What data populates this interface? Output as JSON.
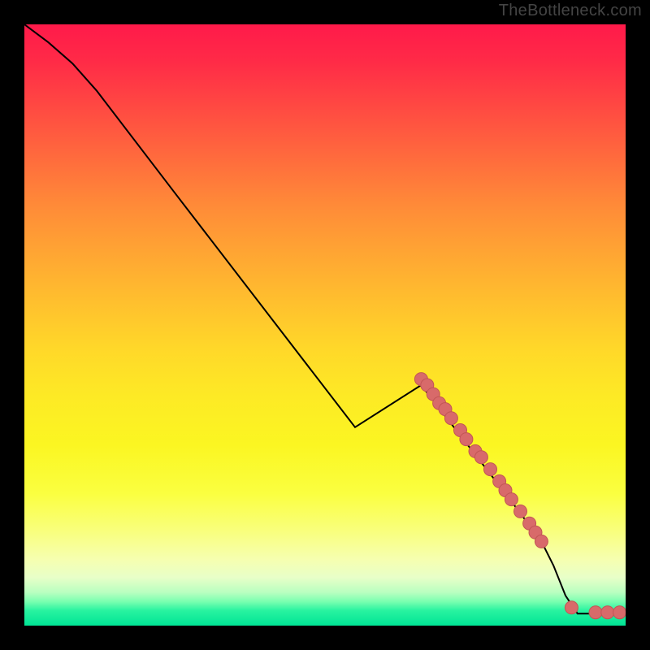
{
  "watermark": "TheBottleneck.com",
  "colors": {
    "curve_stroke": "#000000",
    "marker_fill": "#d86a6a",
    "marker_stroke": "#c25555"
  },
  "chart_data": {
    "type": "line",
    "title": "",
    "xlabel": "",
    "ylabel": "",
    "xlim": [
      0,
      100
    ],
    "ylim": [
      0,
      100
    ],
    "grid": false,
    "legend": false,
    "curve": [
      {
        "x": 0,
        "y": 100
      },
      {
        "x": 4,
        "y": 97
      },
      {
        "x": 8,
        "y": 93.5
      },
      {
        "x": 12,
        "y": 89
      },
      {
        "x": 25,
        "y": 72
      },
      {
        "x": 40,
        "y": 52.5
      },
      {
        "x": 55,
        "y": 33
      },
      {
        "x": 66,
        "y": 40
      },
      {
        "x": 80,
        "y": 22
      },
      {
        "x": 86,
        "y": 14
      },
      {
        "x": 88,
        "y": 10
      },
      {
        "x": 90,
        "y": 5
      },
      {
        "x": 92,
        "y": 2
      },
      {
        "x": 95,
        "y": 2
      },
      {
        "x": 100,
        "y": 2
      }
    ],
    "markers": [
      {
        "x": 66,
        "y": 41
      },
      {
        "x": 67,
        "y": 40
      },
      {
        "x": 68,
        "y": 38.5
      },
      {
        "x": 69,
        "y": 37
      },
      {
        "x": 70,
        "y": 36
      },
      {
        "x": 71,
        "y": 34.5
      },
      {
        "x": 72.5,
        "y": 32.5
      },
      {
        "x": 73.5,
        "y": 31
      },
      {
        "x": 75,
        "y": 29
      },
      {
        "x": 76,
        "y": 28
      },
      {
        "x": 77.5,
        "y": 26
      },
      {
        "x": 79,
        "y": 24
      },
      {
        "x": 80,
        "y": 22.5
      },
      {
        "x": 81,
        "y": 21
      },
      {
        "x": 82.5,
        "y": 19
      },
      {
        "x": 84,
        "y": 17
      },
      {
        "x": 85,
        "y": 15.5
      },
      {
        "x": 86,
        "y": 14
      },
      {
        "x": 91,
        "y": 3
      },
      {
        "x": 95,
        "y": 2.2
      },
      {
        "x": 97,
        "y": 2.2
      },
      {
        "x": 99,
        "y": 2.2
      }
    ]
  }
}
